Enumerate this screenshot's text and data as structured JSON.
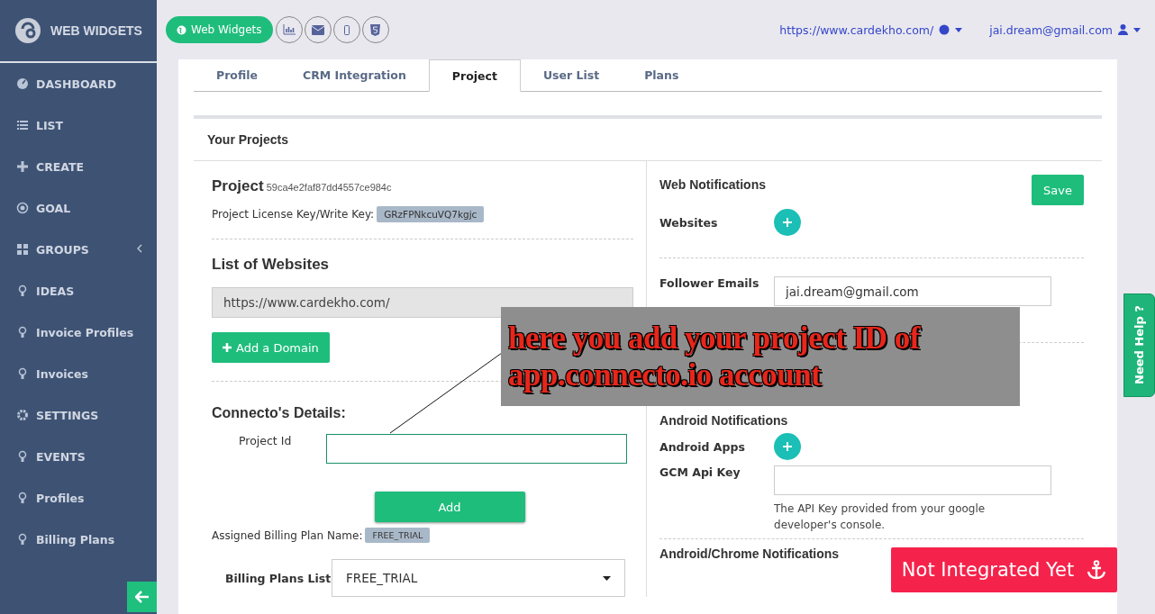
{
  "sidebar": {
    "brand": "WEB WIDGETS",
    "items": [
      {
        "label": "DASHBOARD",
        "has_submenu": false
      },
      {
        "label": "LIST",
        "has_submenu": false
      },
      {
        "label": "CREATE",
        "has_submenu": false
      },
      {
        "label": "GOAL",
        "has_submenu": false
      },
      {
        "label": "GROUPS",
        "has_submenu": true
      },
      {
        "label": "IDEAS",
        "has_submenu": false
      },
      {
        "label": "Invoice Profiles",
        "has_submenu": false
      },
      {
        "label": "Invoices",
        "has_submenu": false
      },
      {
        "label": "SETTINGS",
        "has_submenu": false
      },
      {
        "label": "EVENTS",
        "has_submenu": false
      },
      {
        "label": "Profiles",
        "has_submenu": false
      },
      {
        "label": "Billing Plans",
        "has_submenu": false
      }
    ]
  },
  "toolbar": {
    "primary_button": "Web Widgets"
  },
  "header": {
    "site": "https://www.cardekho.com/",
    "user": "jai.dream@gmail.com"
  },
  "tabs": [
    {
      "label": "Profile",
      "selected": false
    },
    {
      "label": "CRM Integration",
      "selected": false
    },
    {
      "label": "Project",
      "selected": true
    },
    {
      "label": "User List",
      "selected": false
    },
    {
      "label": "Plans",
      "selected": false
    }
  ],
  "section_title": "Your Projects",
  "project": {
    "heading": "Project",
    "id": "59ca4e2faf87dd4557ce984c",
    "license_label": "Project License Key/Write Key:",
    "license_key": "GRzFPNkcuVQ7kgjc"
  },
  "websites": {
    "heading": "List of Websites",
    "items": [
      "https://www.cardekho.com/"
    ],
    "add_button": "Add a Domain"
  },
  "connecto": {
    "heading": "Connecto's Details:",
    "field_label": "Project Id",
    "button": "Add"
  },
  "billing": {
    "assigned_label": "Assigned Billing Plan Name:",
    "assigned_plan": "FREE_TRIAL",
    "list_label": "Billing Plans List",
    "selected_plan": "FREE_TRIAL"
  },
  "web_notifications": {
    "heading": "Web Notifications",
    "save_button": "Save",
    "websites_label": "Websites",
    "follower_label": "Follower Emails",
    "follower_value": "jai.dream@gmail.com"
  },
  "android": {
    "heading": "Android Notifications",
    "apps_label": "Android Apps",
    "gcm_label": "GCM Api Key",
    "gcm_hint": "The API Key provided from your google developer's console."
  },
  "chrome_heading": "Android/Chrome Notifications",
  "status_button": "Not Integrated Yet",
  "help_tab": "Need Help ?",
  "annotation": {
    "lines": [
      "here you add your project ID of",
      "app.connecto.io account"
    ]
  }
}
